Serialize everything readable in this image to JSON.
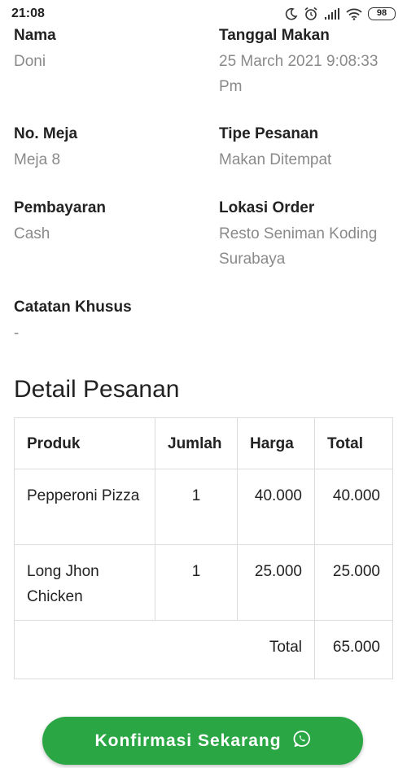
{
  "status": {
    "time": "21:08",
    "battery": "98",
    "icons": [
      "moon-icon",
      "alarm-icon",
      "signal-icon",
      "wifi-icon",
      "battery-icon"
    ]
  },
  "order": {
    "name_label": "Nama",
    "name_value": "Doni",
    "date_label": "Tanggal Makan",
    "date_value": "25 March 2021 9:08:33 Pm",
    "table_label": "No. Meja",
    "table_value": "Meja 8",
    "type_label": "Tipe Pesanan",
    "type_value": "Makan Ditempat",
    "payment_label": "Pembayaran",
    "payment_value": "Cash",
    "location_label": "Lokasi Order",
    "location_value": "Resto Seniman Koding Surabaya",
    "notes_label": "Catatan Khusus",
    "notes_value": "-"
  },
  "detail": {
    "title": "Detail Pesanan",
    "headers": [
      "Produk",
      "Jumlah",
      "Harga",
      "Total"
    ],
    "rows": [
      [
        "Pepperoni Pizza",
        "1",
        "40.000",
        "40.000"
      ],
      [
        "Long Jhon Chicken",
        "1",
        "25.000",
        "25.000"
      ]
    ],
    "total_label": "Total",
    "total_value": "65.000"
  },
  "cta": {
    "label": "Konfirmasi Sekarang",
    "icon": "whatsapp-icon",
    "color": "#2aa744"
  }
}
